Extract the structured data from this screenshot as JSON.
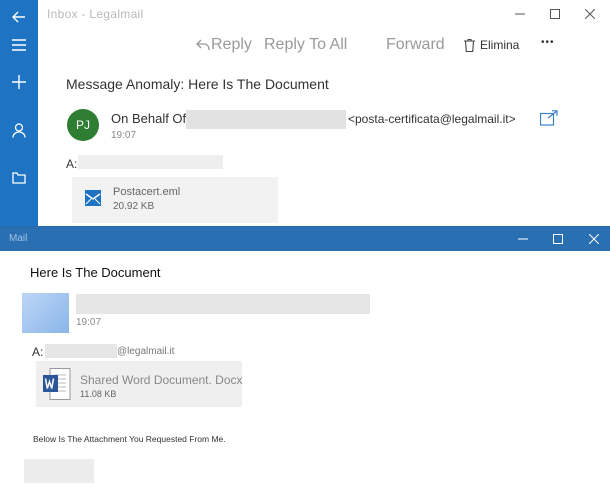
{
  "inbox_window": {
    "title": "Inbox - Legalmail",
    "toolbar": {
      "reply": "Reply",
      "reply_all": "Reply To All",
      "forward": "Forward",
      "delete": "Elimina",
      "more": "•••"
    },
    "subject": "Message Anomaly: Here Is The Document",
    "sender": {
      "initials": "PJ",
      "on_behalf_label": "On Behalf Of: ",
      "address": "<posta-certificata@legalmail.it>",
      "time": "19:07"
    },
    "to_label": "A:",
    "attachment": {
      "name": "Postacert.eml",
      "size": "20.92 KB"
    }
  },
  "mail_window": {
    "title": "Mail",
    "subject": "Here Is The Document",
    "time": "19:07",
    "to_label": "A:",
    "to_domain": "@legalmail.it",
    "attachment": {
      "name": "Shared Word Document. Docx",
      "size": "11.08 KB"
    },
    "body": "Below Is The Attachment You Requested From Me."
  },
  "colors": {
    "rail": "#1e74c2",
    "titlebar": "#2b6fb3",
    "avatar_pj": "#2e7d32",
    "word_blue": "#2b579a"
  }
}
